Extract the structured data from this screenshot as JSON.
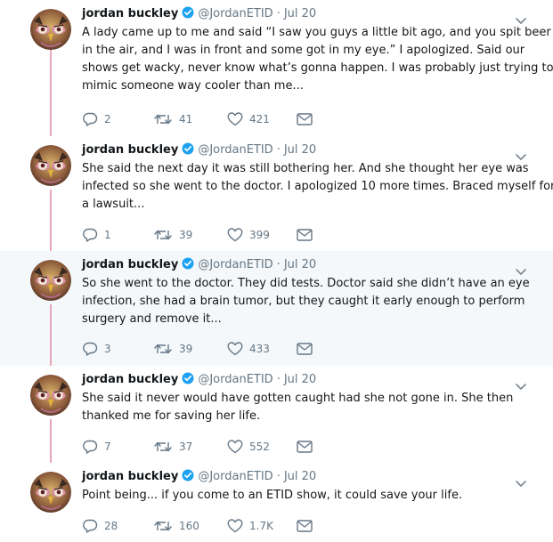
{
  "colors": {
    "thread_line": "#e8a6b8",
    "name_text": "#14171a",
    "meta_text": "#657786",
    "verified_badge": "#1da1f2",
    "highlight_bg": "#f5f8fa"
  },
  "icons": {
    "reply": "reply-icon",
    "retweet": "retweet-icon",
    "like": "heart-icon",
    "message": "envelope-icon",
    "verified": "verified-badge-icon",
    "menu": "chevron-down-icon"
  },
  "tweets": [
    {
      "name": "jordan buckley",
      "handle": "@JordanETID",
      "sep": "·",
      "date": "Jul 20",
      "lines": [
        "A lady came up to me and said “I saw you guys a little bit ago, and you spit beer",
        "in the air, and I was in front and some got in my eye.” I apologized. Said our",
        "shows get wacky, never know what’s gonna happen. I was probably just trying to",
        "mimic someone way cooler than me..."
      ],
      "replies": "2",
      "retweets": "41",
      "likes": "421"
    },
    {
      "name": "jordan buckley",
      "handle": "@JordanETID",
      "sep": "·",
      "date": "Jul 20",
      "lines": [
        "She said the next day it was still bothering her. And she thought her eye was",
        "infected so she went to the doctor. I apologized 10 more times. Braced myself for",
        "a lawsuit..."
      ],
      "replies": "1",
      "retweets": "39",
      "likes": "399"
    },
    {
      "name": "jordan buckley",
      "handle": "@JordanETID",
      "sep": "·",
      "date": "Jul 20",
      "lines": [
        "So she went to the doctor. They did tests. Doctor said she didn’t have an eye",
        "infection, she had a brain tumor, but they caught it early enough to perform",
        "surgery and remove it..."
      ],
      "replies": "3",
      "retweets": "39",
      "likes": "433"
    },
    {
      "name": "jordan buckley",
      "handle": "@JordanETID",
      "sep": "·",
      "date": "Jul 20",
      "lines": [
        "She said it never would have gotten caught had she not gone in. She then",
        "thanked me for saving her life."
      ],
      "replies": "7",
      "retweets": "37",
      "likes": "552"
    },
    {
      "name": "jordan buckley",
      "handle": "@JordanETID",
      "sep": "·",
      "date": "Jul 20",
      "lines": [
        "Point being... if you come to an ETID show, it could save your life."
      ],
      "replies": "28",
      "retweets": "160",
      "likes": "1.7K"
    }
  ]
}
